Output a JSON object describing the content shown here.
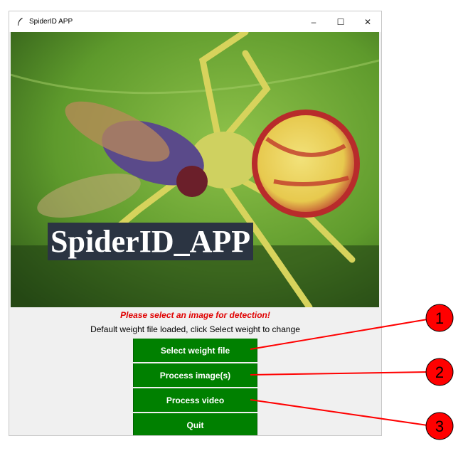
{
  "window": {
    "title": "SpiderID APP",
    "minimize_glyph": "–",
    "maximize_glyph": "☐",
    "close_glyph": "✕"
  },
  "banner": {
    "text": "SpiderID_APP"
  },
  "status": {
    "prompt": "Please select an image for detection!",
    "info": "Default weight file loaded, click Select weight to change"
  },
  "buttons": {
    "select_weight": "Select weight file",
    "process_images": "Process image(s)",
    "process_video": "Process video",
    "quit": "Quit"
  },
  "callouts": [
    "1",
    "2",
    "3"
  ],
  "colors": {
    "button_green": "#008000",
    "prompt_red": "#e00000",
    "callout_red": "#ff0000",
    "banner_bg": "#2b3442"
  },
  "icons": {
    "app": "feather-icon"
  }
}
